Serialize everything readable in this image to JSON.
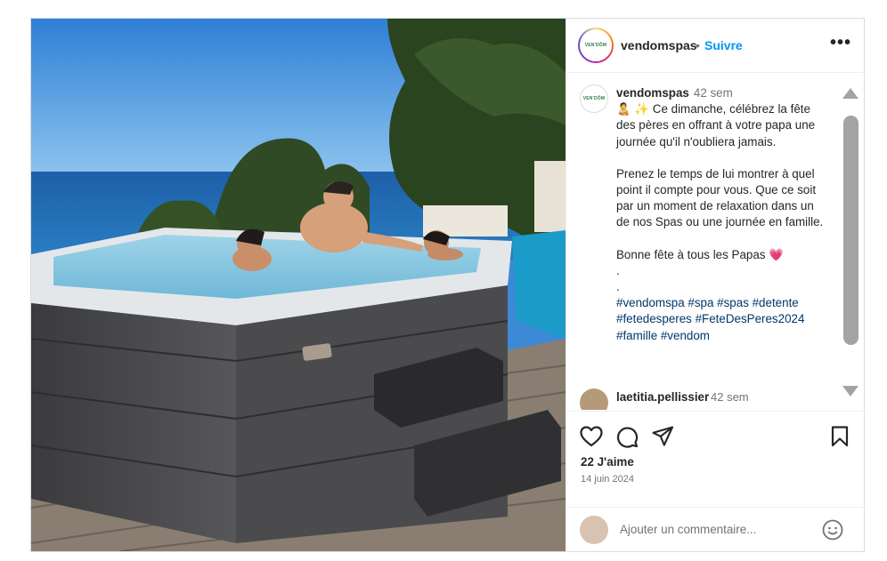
{
  "post": {
    "username": "vendomspas",
    "follow_label": "Suivre",
    "dot": "•",
    "more_label": "•••",
    "logo_text": "VEN'DÔM"
  },
  "caption": {
    "username": "vendomspas",
    "time": "42 sem",
    "line1": "🧑‍🍼 ✨ Ce dimanche, célébrez la fête des pères en offrant à votre papa une journée qu'il n'oubliera jamais.",
    "line2": "Prenez le temps de lui montrer à quel point il compte pour vous. Que ce soit par un moment de relaxation dans un de nos Spas ou une journée en famille.",
    "line3": "Bonne fête à tous les Papas 💗",
    "dot1": ".",
    "dot2": ".",
    "hashtags": "#vendomspa #spa #spas #detente #fetedesperes #FeteDesPeres2024 #famille #vendom"
  },
  "comment2": {
    "username": "laetitia.pellissier",
    "time": "42 sem"
  },
  "engagement": {
    "likes": "22 J'aime",
    "date": "14 juin 2024"
  },
  "add_comment": {
    "placeholder": "Ajouter un commentaire..."
  },
  "icons": [
    "heart-icon",
    "comment-icon",
    "share-icon",
    "bookmark-icon",
    "emoji-icon",
    "more-icon"
  ]
}
